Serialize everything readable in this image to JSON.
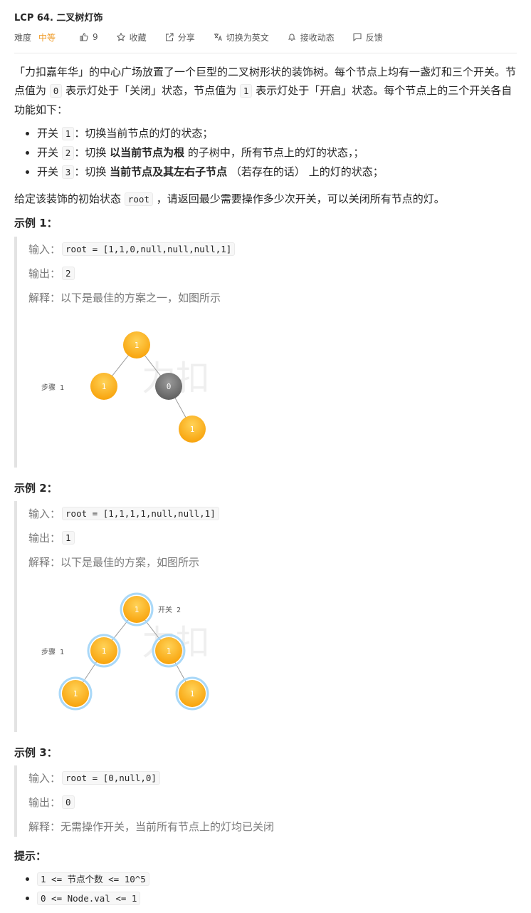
{
  "problem": {
    "title": "LCP 64. 二叉树灯饰"
  },
  "meta": {
    "difficulty_label": "难度",
    "difficulty": "中等",
    "likes": "9",
    "favorite": "收藏",
    "share": "分享",
    "switch_lang": "切换为英文",
    "subscribe": "接收动态",
    "feedback": "反馈",
    "colors": {
      "difficulty": "#ef9a25"
    }
  },
  "desc": {
    "p1": "「力扣嘉年华」的中心广场放置了一个巨型的二叉树形状的装饰树。每个节点上均有一盏灯和三个开关。节点值为",
    "p1_code1": "0",
    "p1_mid": "表示灯处于「关闭」状态，节点值为",
    "p1_code2": "1",
    "p1_end": "表示灯处于「开启」状态。每个节点上的三个开关各自功能如下：",
    "switches": [
      {
        "pre": "开关",
        "code": "1",
        "text": "：切换当前节点的灯的状态；",
        "bold": "",
        "after": ""
      },
      {
        "pre": "开关",
        "code": "2",
        "text": "：切换",
        "bold": "以当前节点为根",
        "after": "的子树中，所有节点上的灯的状态，；"
      },
      {
        "pre": "开关",
        "code": "3",
        "text": "：切换",
        "bold": "当前节点及其左右子节点",
        "after": "（若存在的话） 上的灯的状态；"
      }
    ],
    "p2_pre": "给定该装饰的初始状态",
    "p2_code": "root",
    "p2_post": "，请返回最少需要操作多少次开关，可以关闭所有节点的灯。"
  },
  "examples": [
    {
      "heading": "示例 1：",
      "input_label": "输入：",
      "input": "root = [1,1,0,null,null,null,1]",
      "output_label": "输出：",
      "output": "2",
      "explain_label": "解释：",
      "explain": "以下是最佳的方案之一，如图所示",
      "figure": {
        "step": "步骤 1",
        "switch": "",
        "nodes": [
          "1",
          "1",
          "0",
          "1"
        ]
      }
    },
    {
      "heading": "示例 2：",
      "input_label": "输入：",
      "input": "root = [1,1,1,1,null,null,1]",
      "output_label": "输出：",
      "output": "1",
      "explain_label": "解释：",
      "explain": "以下是最佳的方案，如图所示",
      "figure": {
        "step": "步骤 1",
        "switch": "开关 2",
        "nodes": [
          "1",
          "1",
          "1",
          "1",
          "1"
        ]
      }
    },
    {
      "heading": "示例 3：",
      "input_label": "输入：",
      "input": "root = [0,null,0]",
      "output_label": "输出：",
      "output": "0",
      "explain_label": "解释：",
      "explain": "无需操作开关，当前所有节点上的灯均已关闭"
    }
  ],
  "tips": {
    "heading": "提示：",
    "items": [
      "1 <= 节点个数 <= 10^5",
      "0 <= Node.val <= 1"
    ]
  },
  "colors": {
    "node_on": "#fbb20f",
    "node_off": "#777777",
    "ring": "#a9d8f8"
  }
}
